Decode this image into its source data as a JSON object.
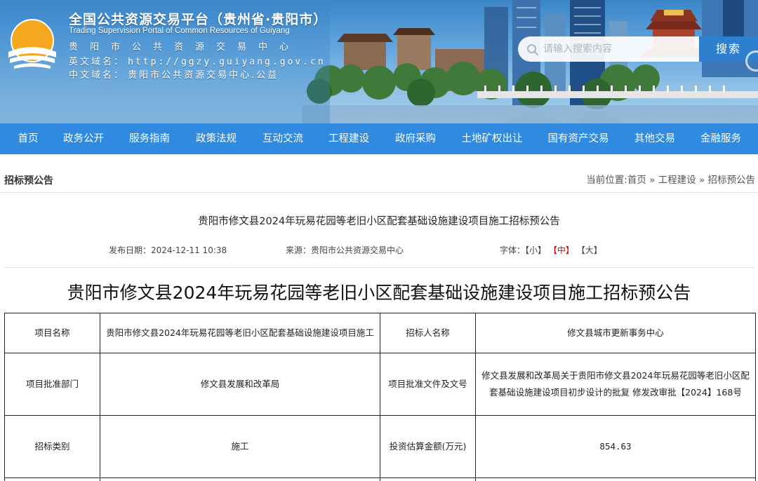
{
  "header": {
    "title": "全国公共资源交易平台（贵州省·贵阳市）",
    "subtitle_en": "Trading Supervision Portal of Common Resources of Guiyang",
    "center_name": "贵阳市公共资源交易中心",
    "domain_en_label": "英文域名：",
    "domain_en_value": "http://ggzy.guiyang.gov.cn",
    "domain_cn_label": "中文域名：",
    "domain_cn_value": "贵阳市公共资源交易中心.公益",
    "search_placeholder": "请输入搜索内容",
    "search_button": "搜索"
  },
  "nav": {
    "items": [
      "首页",
      "政务公开",
      "服务指南",
      "政策法规",
      "互动交流",
      "工程建设",
      "政府采购",
      "土地矿权出让",
      "国有资产交易",
      "其他交易",
      "金融服务"
    ]
  },
  "location": {
    "section_title": "招标预公告",
    "breadcrumb": "当前位置:首页 » 工程建设 » 招标预公告"
  },
  "article": {
    "title": "贵阳市修文县2024年玩易花园等老旧小区配套基础设施建设项目施工招标预公告",
    "publish_date": "发布日期：2024-12-11 10:38",
    "source": "来源：贵阳市公共资源交易中心",
    "font_label": "字体：",
    "font_small": "【小】",
    "font_medium": "【中】",
    "font_large": "【大】",
    "heading": "贵阳市修文县2024年玩易花园等老旧小区配套基础设施建设项目施工招标预公告"
  },
  "table": {
    "rows": [
      [
        "项目名称",
        "贵阳市修文县2024年玩易花园等老旧小区配套基础设施建设项目施工",
        "招标人名称",
        "修文县城市更新事务中心"
      ],
      [
        "项目批准部门",
        "修文县发展和改革局",
        "项目批准文件及文号",
        "修文县发展和改革局关于贵阳市修文县2024年玩易花园等老旧小区配套基础设施建设项目初步设计的批复 修发改审批【2024】168号"
      ],
      [
        "招标类别",
        "施工",
        "投资估算金额(万元)",
        "854.63"
      ]
    ]
  },
  "colors": {
    "nav": "#2f8ae0",
    "search_button": "#2f7fd1",
    "highlight": "#d40000"
  }
}
